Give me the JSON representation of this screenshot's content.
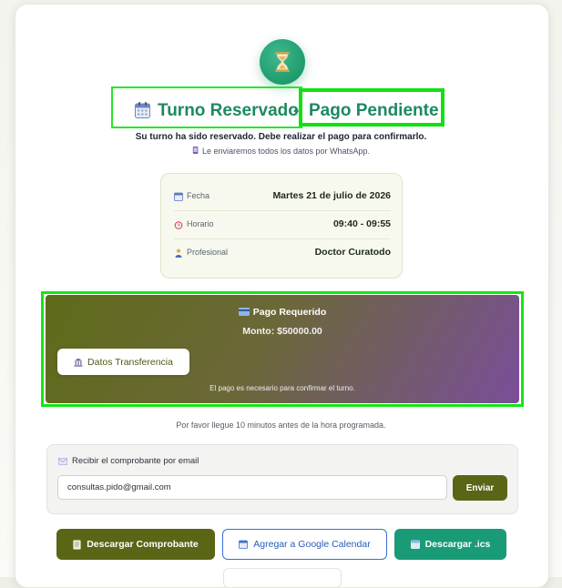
{
  "header": {
    "status_icon": "hourglass-icon",
    "title_main": "Turno Reservado",
    "title_separator": "-",
    "title_status": "Pago Pendiente",
    "subtitle": "Su turno ha sido reservado. Debe realizar el pago para confirmarlo.",
    "whatsapp_note": "Le enviaremos todos los datos por WhatsApp."
  },
  "details": [
    {
      "icon": "calendar-icon",
      "label": "Fecha",
      "value": "Martes 21 de julio de 2026"
    },
    {
      "icon": "alarm-clock-icon",
      "label": "Horario",
      "value": "09:40 - 09:55"
    },
    {
      "icon": "person-icon",
      "label": "Profesional",
      "value": "Doctor Curatodo"
    }
  ],
  "payment": {
    "title": "Pago Requerido",
    "amount": "Monto: $50000.00",
    "transfer_button": "Datos Transferencia",
    "note": "El pago es necesario para confirmar el turno."
  },
  "arrival_note": "Por favor llegue 10 minutos antes de la hora programada.",
  "email": {
    "label": "Recibir el comprobante por email",
    "value": "consultas.pido@gmail.com",
    "send_button": "Enviar"
  },
  "actions": {
    "download_receipt": "Descargar Comprobante",
    "google_calendar": "Agregar a Google Calendar",
    "download_ics": "Descargar .ics"
  },
  "colors": {
    "accent_green": "#1c8a5f",
    "olive": "#5b6516",
    "teal": "#1a9b77",
    "google_blue": "#3b6fd0",
    "highlight": "#14e614"
  }
}
